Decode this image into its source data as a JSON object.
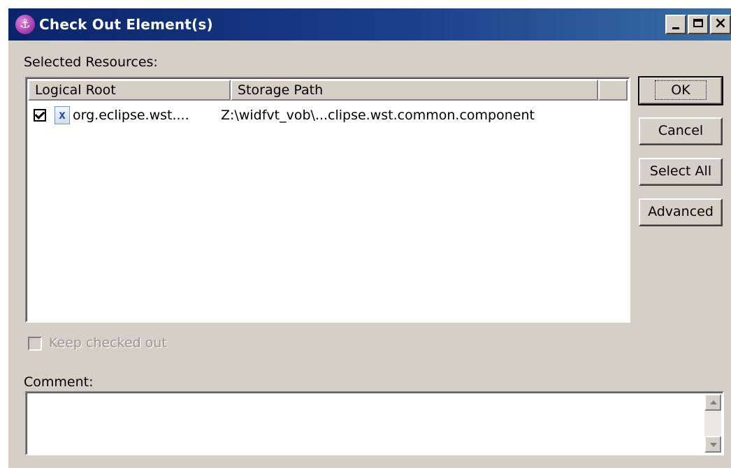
{
  "window": {
    "title": "Check Out Element(s)",
    "minimize_glyph": "_",
    "close_glyph": "×"
  },
  "resources": {
    "label": "Selected Resources:",
    "columns": [
      "Logical Root",
      "Storage Path"
    ],
    "rows": [
      {
        "checked": true,
        "icon": "x",
        "logical_root": "org.eclipse.wst....",
        "storage_path": "Z:\\widfvt_vob\\...clipse.wst.common.component"
      }
    ]
  },
  "buttons": {
    "ok": "OK",
    "cancel": "Cancel",
    "select_all": "Select All",
    "advanced": "Advanced"
  },
  "keep_checked_out": {
    "label": "Keep checked out",
    "checked": false,
    "enabled": false
  },
  "comment": {
    "label": "Comment:",
    "value": ""
  }
}
